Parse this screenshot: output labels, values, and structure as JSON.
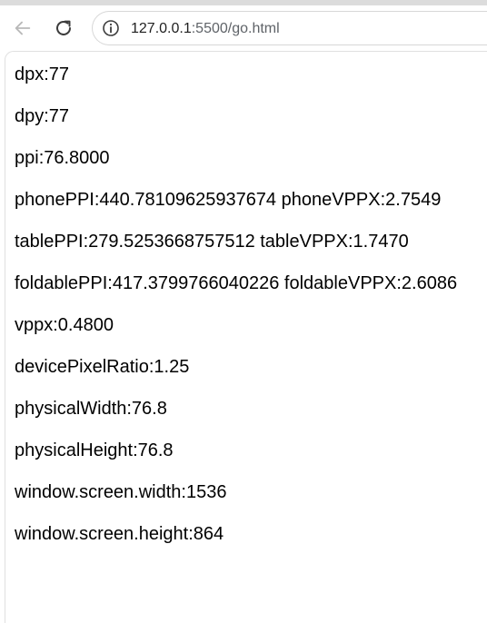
{
  "browser": {
    "url_host": "127.0.0.1",
    "url_rest": ":5500/go.html",
    "icons": {
      "back": "arrow-left-icon",
      "reload": "reload-icon",
      "site_info": "info-icon"
    }
  },
  "lines": [
    "dpx:77",
    "dpy:77",
    "ppi:76.8000",
    "phonePPI:440.78109625937674 phoneVPPX:2.7549",
    "tablePPI:279.5253668757512 tableVPPX:1.7470",
    "foldablePPI:417.3799766040226 foldableVPPX:2.6086",
    "vppx:0.4800",
    "devicePixelRatio:1.25",
    "physicalWidth:76.8",
    "physicalHeight:76.8",
    "window.screen.width:1536",
    "window.screen.height:864"
  ]
}
